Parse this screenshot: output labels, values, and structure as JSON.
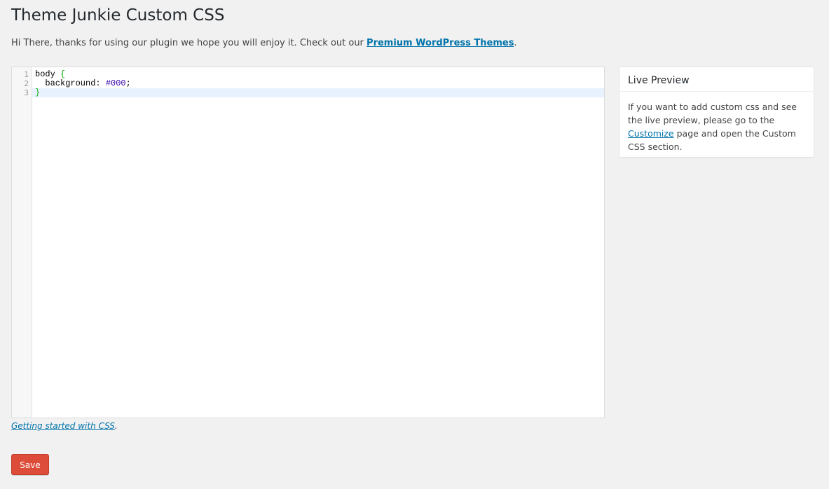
{
  "page": {
    "title": "Theme Junkie Custom CSS",
    "intro_text": "Hi There, thanks for using our plugin we hope you will enjoy it. Check out our ",
    "intro_link": "Premium WordPress Themes",
    "intro_end": "."
  },
  "editor": {
    "line_numbers": [
      "1",
      "2",
      "3"
    ],
    "lines": {
      "l1_selector": "body",
      "l1_brace": " {",
      "l2_prop": "  background: ",
      "l2_value": "#000",
      "l2_end": ";",
      "l3_brace": "}"
    }
  },
  "help": {
    "link": "Getting started with CSS",
    "end": "."
  },
  "save_label": "Save",
  "preview": {
    "title": "Live Preview",
    "text_before": "If you want to add custom css and see the live preview, please go to the ",
    "link": "Customize",
    "text_after": " page and open the Custom CSS section."
  },
  "colors": {
    "save_button": "#dd4b39",
    "link": "#0073aa",
    "background": "#f1f1f1",
    "active_line": "#e8f2fe"
  }
}
